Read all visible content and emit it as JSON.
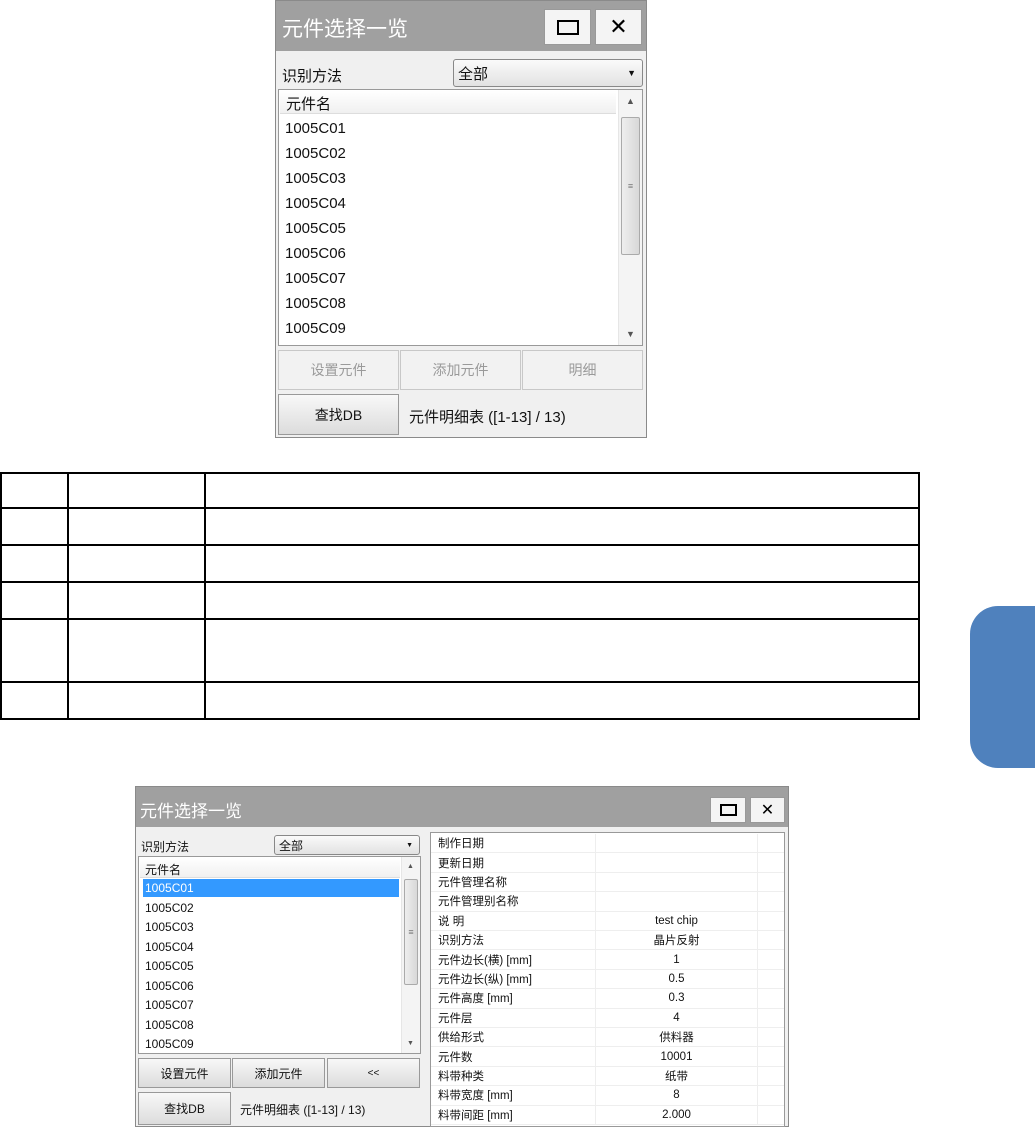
{
  "dialog1": {
    "title": "元件选择一览",
    "method_label": "识别方法",
    "method_value": "全部",
    "list_header": "元件名",
    "items": [
      "1005C01",
      "1005C02",
      "1005C03",
      "1005C04",
      "1005C05",
      "1005C06",
      "1005C07",
      "1005C08",
      "1005C09"
    ],
    "buttons": {
      "set": "设置元件",
      "add": "添加元件",
      "detail": "明细",
      "find": "查找DB"
    },
    "status": "元件明细表 ([1-13] / 13)"
  },
  "dialog2": {
    "title": "元件选择一览",
    "method_label": "识别方法",
    "method_value": "全部",
    "list_header": "元件名",
    "items": [
      "1005C01",
      "1005C02",
      "1005C03",
      "1005C04",
      "1005C05",
      "1005C06",
      "1005C07",
      "1005C08",
      "1005C09"
    ],
    "selected": "1005C01",
    "buttons": {
      "set": "设置元件",
      "add": "添加元件",
      "collapse": "<<",
      "find": "查找DB"
    },
    "status": "元件明细表 ([1-13] / 13)",
    "details": [
      {
        "k": "制作日期",
        "v": ""
      },
      {
        "k": "更新日期",
        "v": ""
      },
      {
        "k": "元件管理名称",
        "v": ""
      },
      {
        "k": "元件管理别名称",
        "v": ""
      },
      {
        "k": "说 明",
        "v": "test chip"
      },
      {
        "k": "识别方法",
        "v": "晶片反射"
      },
      {
        "k": "元件边长(横) [mm]",
        "v": "1"
      },
      {
        "k": "元件边长(纵) [mm]",
        "v": "0.5"
      },
      {
        "k": "元件高度 [mm]",
        "v": "0.3"
      },
      {
        "k": "元件层",
        "v": "4"
      },
      {
        "k": "供给形式",
        "v": "供料器"
      },
      {
        "k": "元件数",
        "v": "10001"
      },
      {
        "k": "料带种类",
        "v": "纸带"
      },
      {
        "k": "料带宽度 [mm]",
        "v": "8"
      },
      {
        "k": "料带间距 [mm]",
        "v": "2.000"
      }
    ]
  },
  "colors": {
    "titlebar": "#a0a0a0",
    "selection": "#3399ff",
    "side_tab": "#4f81bd"
  }
}
